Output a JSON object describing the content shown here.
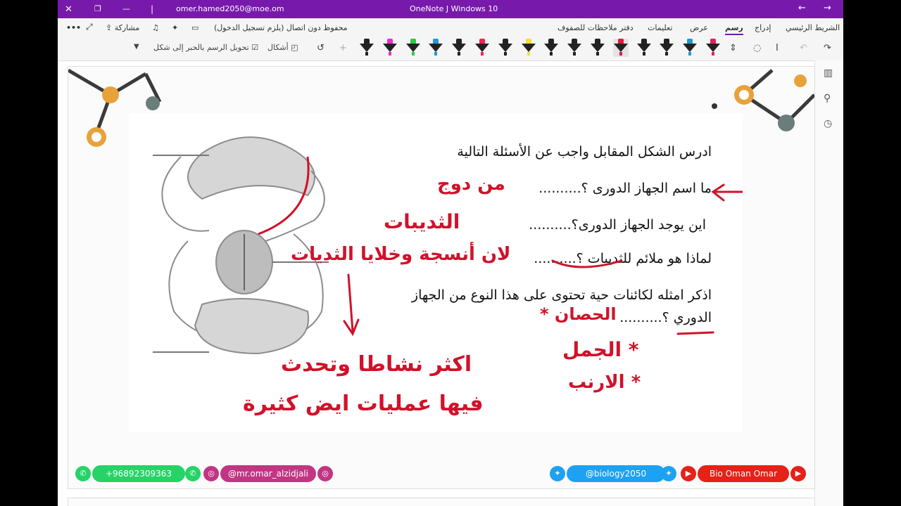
{
  "titlebar": {
    "account": "omer.hamed2050@moe.om",
    "app_title": "OneNote J Windows 10",
    "back_label": "←",
    "forward_label": "→"
  },
  "ribbon": {
    "tabs": [
      "الشريط الرئيسي",
      "إدراج",
      "رسم",
      "عرض",
      "تعليمات",
      "دفتر ملاحظات للصفوف"
    ],
    "active_tab": "رسم",
    "status": "محفوظ دون اتصال (يلزم تسجيل الدخول)",
    "share": "مشاركة",
    "more": "•••"
  },
  "toolbar": {
    "ink_to_shape": "تحويل الرسم بالحبر إلى شكل",
    "shapes": "أشكال",
    "pen_colors": [
      "#222222",
      "#ef2bd2",
      "#2ecc40",
      "#1f9ad6",
      "#222222",
      "#ff1e56",
      "#222222",
      "#f4e02a",
      "#222222",
      "#222222",
      "#222222",
      "#e8183a",
      "#222222",
      "#222222",
      "#1f9ad6",
      "#e91e63"
    ]
  },
  "colors": {
    "accent": "#7719aa",
    "ink_red": "#d0122a",
    "whatsapp": "#25d366",
    "instagram": "#c13584",
    "twitter": "#1da1f2",
    "youtube": "#e62117"
  },
  "worksheet": {
    "instruction": "ادرس الشكل المقابل واجب عن الأسئلة التالية",
    "q1": "ما اسم الجهاز الدورى ؟..........",
    "q2": "اين يوجد الجهاز الدورى؟..........",
    "q3": "لماذا هو ملائم للثدييات ؟..........",
    "q4_line1": "اذكر امثله لكائنات حية تحتوى على هذا النوع من الجهاز",
    "q4_line2": "الدوري ؟.........."
  },
  "handwriting": {
    "a1": "من دوج",
    "a2": "الثديبات",
    "a3": "لان أنسجة وخلايا الثديات",
    "a3_cont_1": "اكثر نشاطا وتحدث",
    "a3_cont_2": "فيها عمليات ايض كثيرة",
    "a4_1": "الحصان *",
    "a4_2": "* الجمل",
    "a4_3": "* الارنب"
  },
  "footer": {
    "whatsapp": "+96892309363",
    "instagram": "@mr.omar_alzidjali",
    "twitter": "@biology2050",
    "youtube": "Bio Oman Omar"
  }
}
